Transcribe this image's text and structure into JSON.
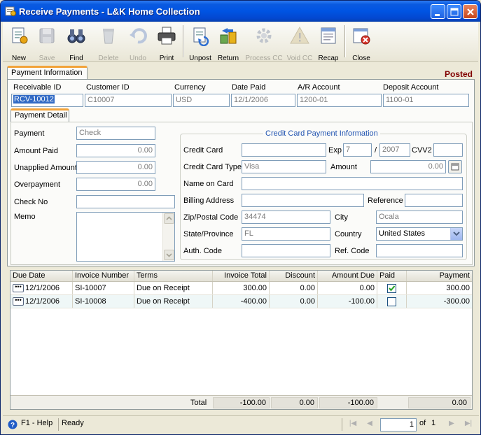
{
  "window": {
    "title": "Receive Payments - L&K Home Collection"
  },
  "toolbar": {
    "items": [
      {
        "label": "New",
        "icon": "new-document-icon",
        "enabled": true
      },
      {
        "label": "Save",
        "icon": "save-disk-icon",
        "enabled": false
      },
      {
        "label": "Find",
        "icon": "binoculars-icon",
        "enabled": true
      },
      {
        "label": "Delete",
        "icon": "recycle-bin-icon",
        "enabled": false
      },
      {
        "label": "Undo",
        "icon": "undo-arrow-icon",
        "enabled": false
      },
      {
        "label": "Print",
        "icon": "printer-icon",
        "enabled": true
      },
      {
        "label": "Unpost",
        "icon": "unpost-icon",
        "enabled": true
      },
      {
        "label": "Return",
        "icon": "money-return-icon",
        "enabled": true
      },
      {
        "label": "Process CC",
        "icon": "process-cc-gear-icon",
        "enabled": false
      },
      {
        "label": "Void CC",
        "icon": "void-cc-warning-icon",
        "enabled": false
      },
      {
        "label": "Recap",
        "icon": "recap-report-icon",
        "enabled": true
      },
      {
        "label": "Close",
        "icon": "close-form-icon",
        "enabled": true
      }
    ]
  },
  "status": "Posted",
  "header": {
    "tab_label": "Payment Information",
    "receivable_id_label": "Receivable ID",
    "receivable_id": "RCV-10012",
    "customer_id_label": "Customer ID",
    "customer_id": "C10007",
    "currency_label": "Currency",
    "currency": "USD",
    "date_paid_label": "Date Paid",
    "date_paid": "12/1/2006",
    "ar_account_label": "A/R Account",
    "ar_account": "1200-01",
    "deposit_account_label": "Deposit Account",
    "deposit_account": "1100-01"
  },
  "detail": {
    "tab_label": "Payment Detail",
    "payment_label": "Payment",
    "payment": "Check",
    "amount_paid_label": "Amount Paid",
    "amount_paid": "0.00",
    "unapplied_label": "Unapplied Amount",
    "unapplied": "0.00",
    "overpayment_label": "Overpayment",
    "overpayment": "0.00",
    "check_no_label": "Check No",
    "check_no": "",
    "memo_label": "Memo",
    "memo": ""
  },
  "credit_card": {
    "legend": "Credit Card Payment Information",
    "card_label": "Credit Card",
    "card": "",
    "exp_label": "Exp",
    "exp_month": "7",
    "exp_sep": "/",
    "exp_year": "2007",
    "cvv_label": "CVV2",
    "cvv": "",
    "type_label": "Credit Card Type",
    "type": "Visa",
    "amount_label": "Amount",
    "amount": "0.00",
    "name_label": "Name on Card",
    "name": "",
    "billing_label": "Billing Address",
    "billing": "",
    "reference_label": "Reference",
    "reference": "",
    "zip_label": "Zip/Postal Code",
    "zip": "34474",
    "city_label": "City",
    "city": "Ocala",
    "state_label": "State/Province",
    "state": "FL",
    "country_label": "Country",
    "country": "United States",
    "auth_label": "Auth. Code",
    "auth": "",
    "ref_code_label": "Ref. Code",
    "ref_code": ""
  },
  "grid": {
    "columns": [
      "Due Date",
      "Invoice Number",
      "Terms",
      "Invoice Total",
      "Discount",
      "Amount Due",
      "Paid",
      "Payment"
    ],
    "rows": [
      {
        "due_date": "12/1/2006",
        "invoice": "SI-10007",
        "terms": "Due on Receipt",
        "total": "300.00",
        "discount": "0.00",
        "amount_due": "0.00",
        "paid": true,
        "payment": "300.00"
      },
      {
        "due_date": "12/1/2006",
        "invoice": "SI-10008",
        "terms": "Due on Receipt",
        "total": "-400.00",
        "discount": "0.00",
        "amount_due": "-100.00",
        "paid": false,
        "payment": "-300.00"
      }
    ],
    "totals_label": "Total",
    "totals": {
      "total": "-100.00",
      "discount": "0.00",
      "amount_due": "-100.00",
      "payment": "0.00"
    }
  },
  "statusbar": {
    "help": "F1 - Help",
    "status": "Ready",
    "page": "1",
    "of_label": "of",
    "page_count": "1"
  }
}
